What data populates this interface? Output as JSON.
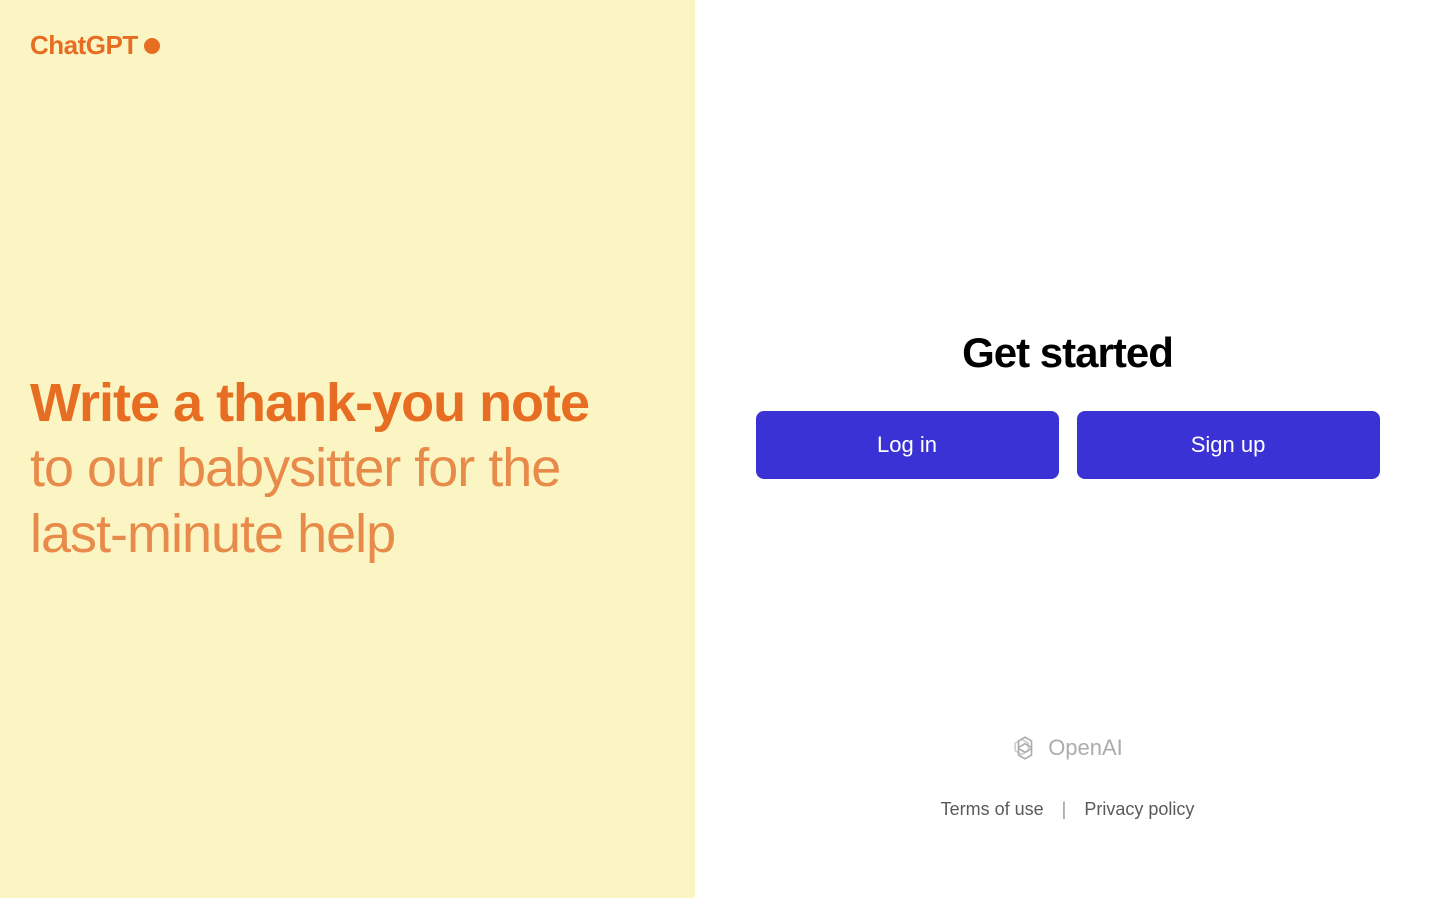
{
  "left": {
    "logo": "ChatGPT",
    "prompt": {
      "bold": "Write a thank-you note",
      "light": "to our babysitter for the last-minute help"
    }
  },
  "right": {
    "heading": "Get started",
    "buttons": {
      "login": "Log in",
      "signup": "Sign up"
    },
    "footer": {
      "brand": "OpenAI",
      "terms": "Terms of use",
      "privacy": "Privacy policy",
      "divider": "|"
    }
  }
}
